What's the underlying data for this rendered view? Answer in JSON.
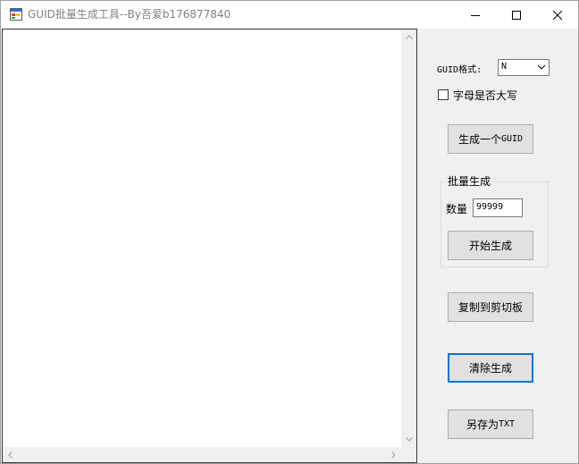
{
  "window": {
    "title": "GUID批量生成工具--By吾爱b176877840"
  },
  "output": {
    "text": ""
  },
  "format": {
    "label": "GUID格式:",
    "selected": "N"
  },
  "uppercase": {
    "label": "字母是否大写",
    "checked": false
  },
  "buttons": {
    "generate_one_prefix": "生成一个",
    "generate_one_suffix": "GUID",
    "start": "开始生成",
    "copy": "复制到剪切板",
    "clear": "清除生成",
    "save_prefix": "另存为",
    "save_suffix": "TXT"
  },
  "batch": {
    "title": "批量生成",
    "count_label": "数量",
    "count_value": "99999"
  },
  "colors": {
    "focus_border": "#0078d7",
    "button_face": "#e1e1e1"
  }
}
